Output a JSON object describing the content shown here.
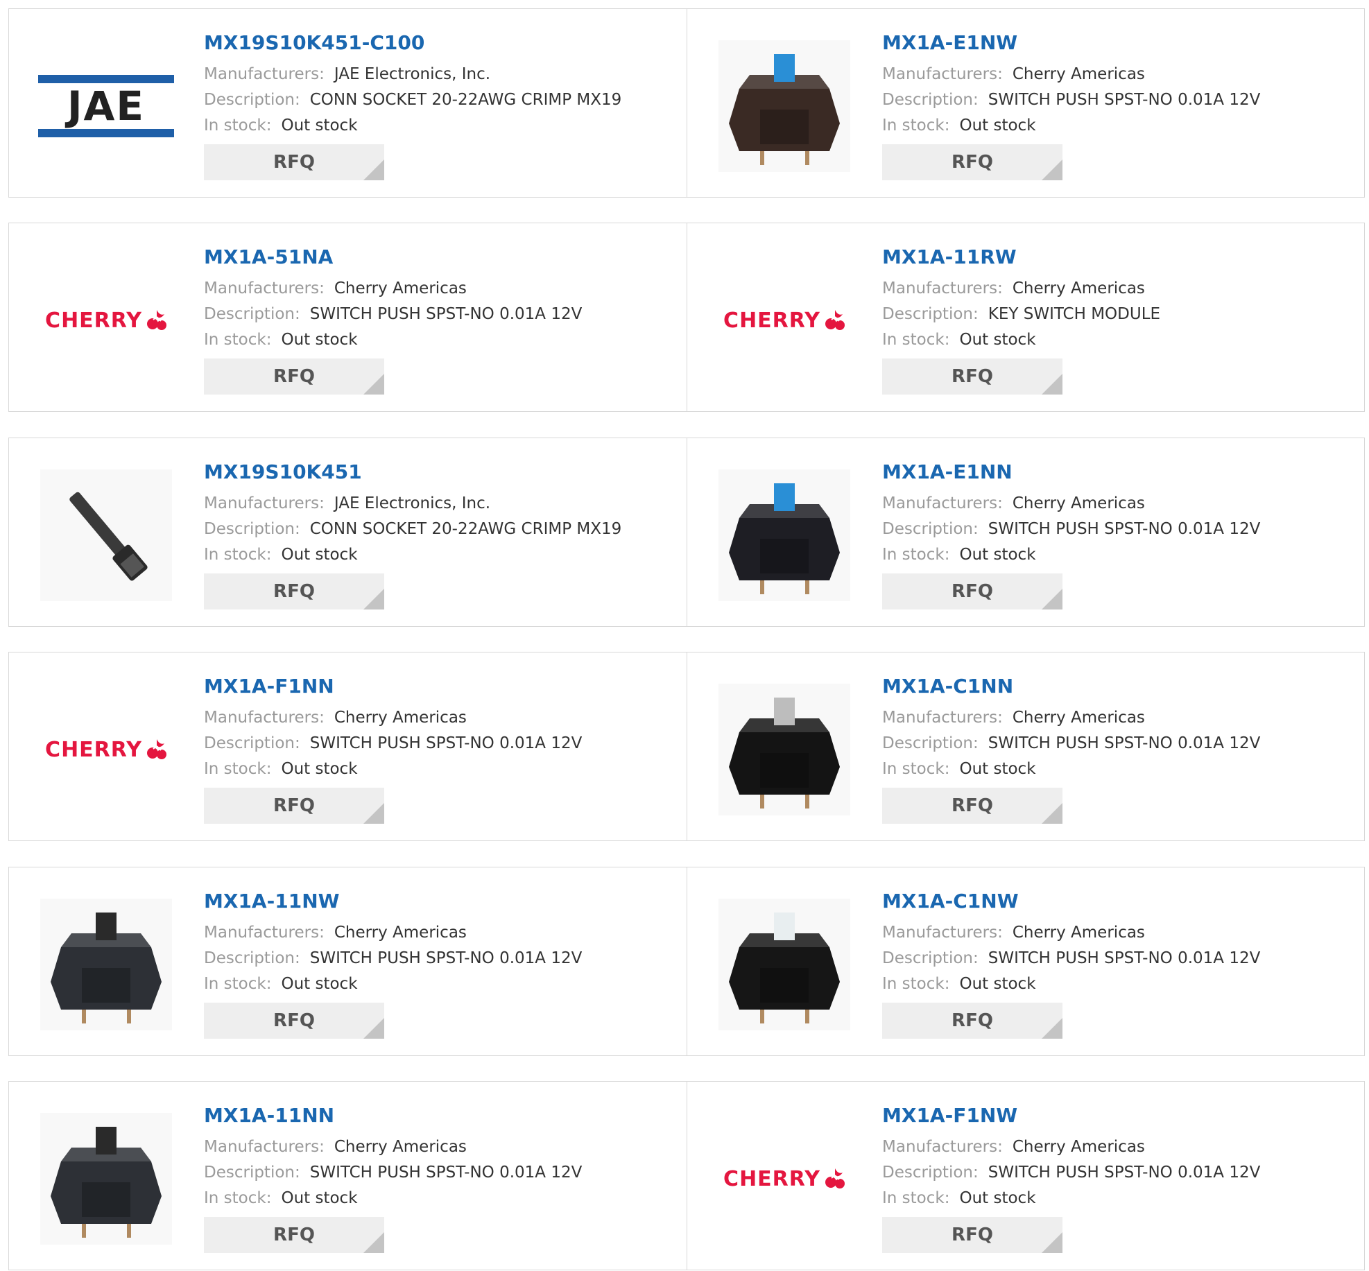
{
  "labels": {
    "manufacturers": "Manufacturers:",
    "description": "Description:",
    "in_stock": "In stock:",
    "rfq": "RFQ"
  },
  "logos": {
    "jae": "JAE",
    "cherry": "CHERRY"
  },
  "products": [
    {
      "part": "MX19S10K451-C100",
      "manufacturer": "JAE Electronics, Inc.",
      "description": "CONN SOCKET 20-22AWG CRIMP MX19",
      "stock": "Out stock",
      "image": "jae-logo"
    },
    {
      "part": "MX1A-E1NW",
      "manufacturer": "Cherry Americas",
      "description": "SWITCH PUSH SPST-NO 0.01A 12V",
      "stock": "Out stock",
      "image": "switch-blue-brown-photo"
    },
    {
      "part": "MX1A-51NA",
      "manufacturer": "Cherry Americas",
      "description": "SWITCH PUSH SPST-NO 0.01A 12V",
      "stock": "Out stock",
      "image": "cherry-logo"
    },
    {
      "part": "MX1A-11RW",
      "manufacturer": "Cherry Americas",
      "description": "KEY SWITCH MODULE",
      "stock": "Out stock",
      "image": "cherry-logo"
    },
    {
      "part": "MX19S10K451",
      "manufacturer": "JAE Electronics, Inc.",
      "description": "CONN SOCKET 20-22AWG CRIMP MX19",
      "stock": "Out stock",
      "image": "crimp-socket-photo"
    },
    {
      "part": "MX1A-E1NN",
      "manufacturer": "Cherry Americas",
      "description": "SWITCH PUSH SPST-NO 0.01A 12V",
      "stock": "Out stock",
      "image": "switch-blue-black-photo"
    },
    {
      "part": "MX1A-F1NN",
      "manufacturer": "Cherry Americas",
      "description": "SWITCH PUSH SPST-NO 0.01A 12V",
      "stock": "Out stock",
      "image": "cherry-logo"
    },
    {
      "part": "MX1A-C1NN",
      "manufacturer": "Cherry Americas",
      "description": "SWITCH PUSH SPST-NO 0.01A 12V",
      "stock": "Out stock",
      "image": "switch-grey-photo"
    },
    {
      "part": "MX1A-11NW",
      "manufacturer": "Cherry Americas",
      "description": "SWITCH PUSH SPST-NO 0.01A 12V",
      "stock": "Out stock",
      "image": "switch-black-photo"
    },
    {
      "part": "MX1A-C1NW",
      "manufacturer": "Cherry Americas",
      "description": "SWITCH PUSH SPST-NO 0.01A 12V",
      "stock": "Out stock",
      "image": "switch-clear-photo"
    },
    {
      "part": "MX1A-11NN",
      "manufacturer": "Cherry Americas",
      "description": "SWITCH PUSH SPST-NO 0.01A 12V",
      "stock": "Out stock",
      "image": "switch-black-photo"
    },
    {
      "part": "MX1A-F1NW",
      "manufacturer": "Cherry Americas",
      "description": "SWITCH PUSH SPST-NO 0.01A 12V",
      "stock": "Out stock",
      "image": "cherry-logo"
    }
  ],
  "colors": {
    "link": "#1a67b0",
    "label": "#9a9a9a",
    "cherry_red": "#e4163f",
    "jae_blue": "#1f5fa8",
    "button_bg": "#eeeeee",
    "border": "#d8d8d8"
  }
}
